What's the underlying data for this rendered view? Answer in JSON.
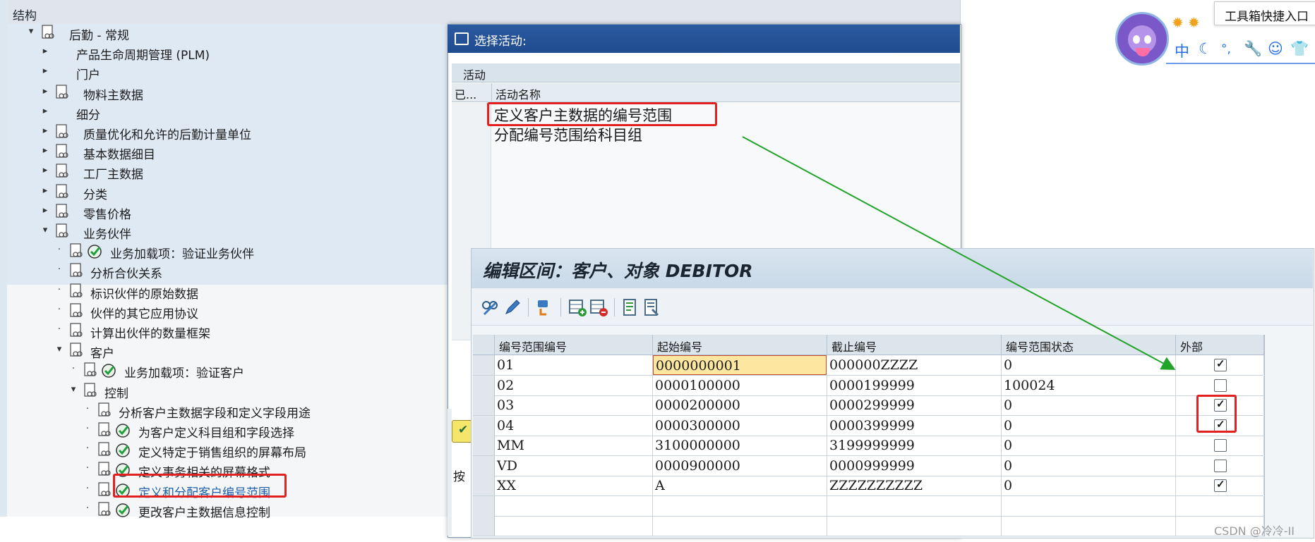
{
  "tree": {
    "header": "结构",
    "nodes": [
      {
        "label": "后勤 - 常规",
        "twisty": "▾",
        "icon": "doc"
      },
      {
        "label": "产品生命周期管理 (PLM)",
        "twisty": "▸",
        "icon": "none"
      },
      {
        "label": "门户",
        "twisty": "▸",
        "icon": "none"
      },
      {
        "label": "物料主数据",
        "twisty": "▸",
        "icon": "doc"
      },
      {
        "label": "细分",
        "twisty": "▸",
        "icon": "none"
      },
      {
        "label": "质量优化和允许的后勤计量单位",
        "twisty": "▸",
        "icon": "doc"
      },
      {
        "label": "基本数据细目",
        "twisty": "▸",
        "icon": "doc"
      },
      {
        "label": "工厂主数据",
        "twisty": "▸",
        "icon": "doc"
      },
      {
        "label": "分类",
        "twisty": "▸",
        "icon": "doc"
      },
      {
        "label": "零售价格",
        "twisty": "▸",
        "icon": "doc"
      },
      {
        "label": "业务伙伴",
        "twisty": "▾",
        "icon": "doc"
      },
      {
        "label": "业务加载项：验证业务伙伴",
        "twisty": "·",
        "icon": "doc+check"
      },
      {
        "label": "分析合伙关系",
        "twisty": "·",
        "icon": "doc"
      },
      {
        "label": "标识伙伴的原始数据",
        "twisty": "·",
        "icon": "doc"
      },
      {
        "label": "伙伴的其它应用协议",
        "twisty": "·",
        "icon": "doc"
      },
      {
        "label": "计算出伙伴的数量框架",
        "twisty": "·",
        "icon": "doc"
      },
      {
        "label": "客户",
        "twisty": "▾",
        "icon": "doc"
      },
      {
        "label": "业务加载项：验证客户",
        "twisty": "·",
        "icon": "doc+check"
      },
      {
        "label": "控制",
        "twisty": "▾",
        "icon": "doc"
      },
      {
        "label": "分析客户主数据字段和定义字段用途",
        "twisty": "·",
        "icon": "doc"
      },
      {
        "label": "为客户定义科目组和字段选择",
        "twisty": "·",
        "icon": "doc+check"
      },
      {
        "label": "定义特定于销售组织的屏幕布局",
        "twisty": "·",
        "icon": "doc+check"
      },
      {
        "label": "定义事务相关的屏幕格式",
        "twisty": "·",
        "icon": "doc+check"
      },
      {
        "label": "定义和分配客户编号范围",
        "twisty": "·",
        "icon": "doc+check"
      },
      {
        "label": "更改客户主数据信息控制",
        "twisty": "·",
        "icon": "doc+check"
      }
    ]
  },
  "popup": {
    "title": "选择活动:",
    "caption": "活动",
    "col_done": "已...",
    "col_name": "活动名称",
    "activities": [
      "定义客户主数据的编号范围",
      "分配编号范围给科目组"
    ],
    "button_label": "✔",
    "bottom_label": "按"
  },
  "edit": {
    "title": "编辑区间：客户、对象 DEBITOR",
    "toolbar": [
      "display-change-icon",
      "pencil-icon",
      "transport-icon",
      "insert-row-icon",
      "delete-row-icon",
      "details-icon",
      "overview-icon"
    ],
    "columns": [
      "编号范围编号",
      "起始编号",
      "截止编号",
      "编号范围状态",
      "外部"
    ],
    "rows": [
      {
        "no": "01",
        "from": "0000000001",
        "to": "000000ZZZZ",
        "status": "0",
        "ext": true
      },
      {
        "no": "02",
        "from": "0000100000",
        "to": "0000199999",
        "status": "100024",
        "ext": false
      },
      {
        "no": "03",
        "from": "0000200000",
        "to": "0000299999",
        "status": "0",
        "ext": true
      },
      {
        "no": "04",
        "from": "0000300000",
        "to": "0000399999",
        "status": "0",
        "ext": true
      },
      {
        "no": "MM",
        "from": "3100000000",
        "to": "3199999999",
        "status": "0",
        "ext": false
      },
      {
        "no": "VD",
        "from": "0000900000",
        "to": "0000999999",
        "status": "0",
        "ext": false
      },
      {
        "no": "XX",
        "from": "A",
        "to": "ZZZZZZZZZZ",
        "status": "0",
        "ext": true
      }
    ]
  },
  "widget": {
    "tooltip": "工具箱快捷入口",
    "ime_items": [
      "中",
      "☾",
      "°,",
      "🔧",
      "☺",
      "👕"
    ]
  },
  "watermark": "CSDN @冷冷-II",
  "colors": {
    "highlight": "#e41f1f",
    "arrow": "#22a32a",
    "title_bar": "#1f4b8f"
  }
}
